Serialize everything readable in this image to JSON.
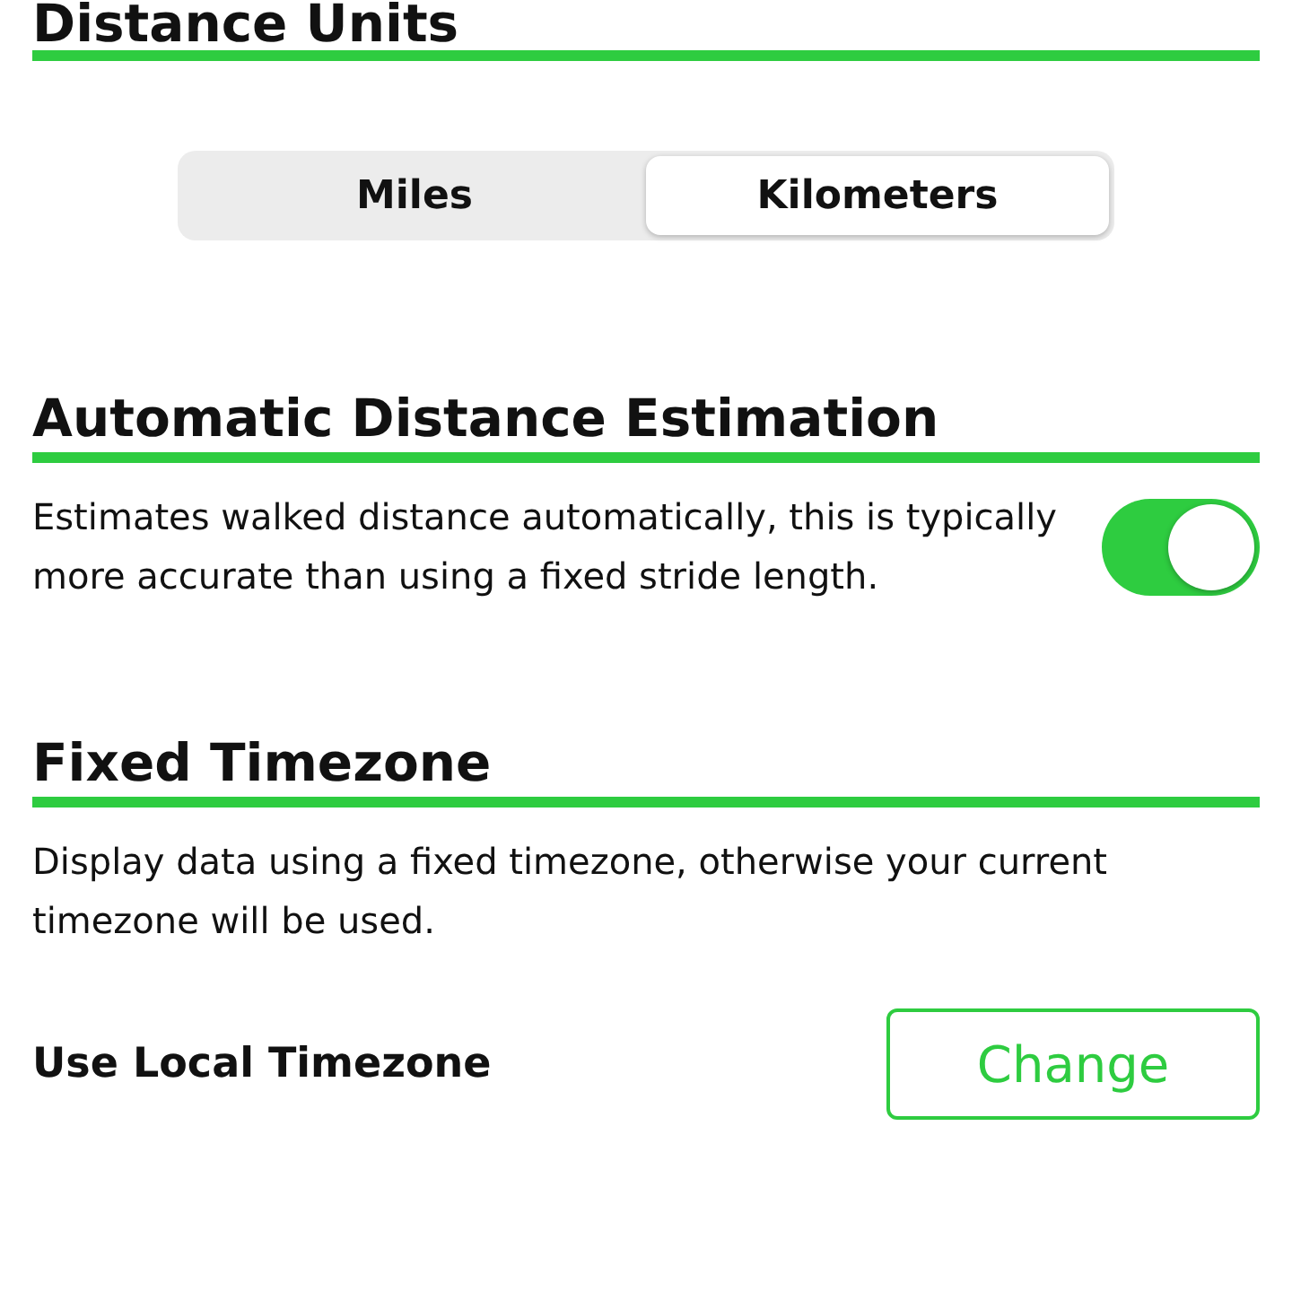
{
  "sections": [
    {
      "kind": "segmented",
      "title": "Distance Units",
      "options": [
        {
          "label": "Miles",
          "selected": false
        },
        {
          "label": "Kilometers",
          "selected": true
        }
      ]
    },
    {
      "kind": "toggle",
      "title": "Automatic Distance Estimation",
      "description": "Estimates walked distance automatically, this is typically more accurate than using a fixed stride length.",
      "on": true
    },
    {
      "kind": "action",
      "title": "Fixed Timezone",
      "description": "Display data using a fixed timezone, otherwise your current timezone will be used.",
      "setting": "Use Local Timezone",
      "button": "Change"
    }
  ]
}
